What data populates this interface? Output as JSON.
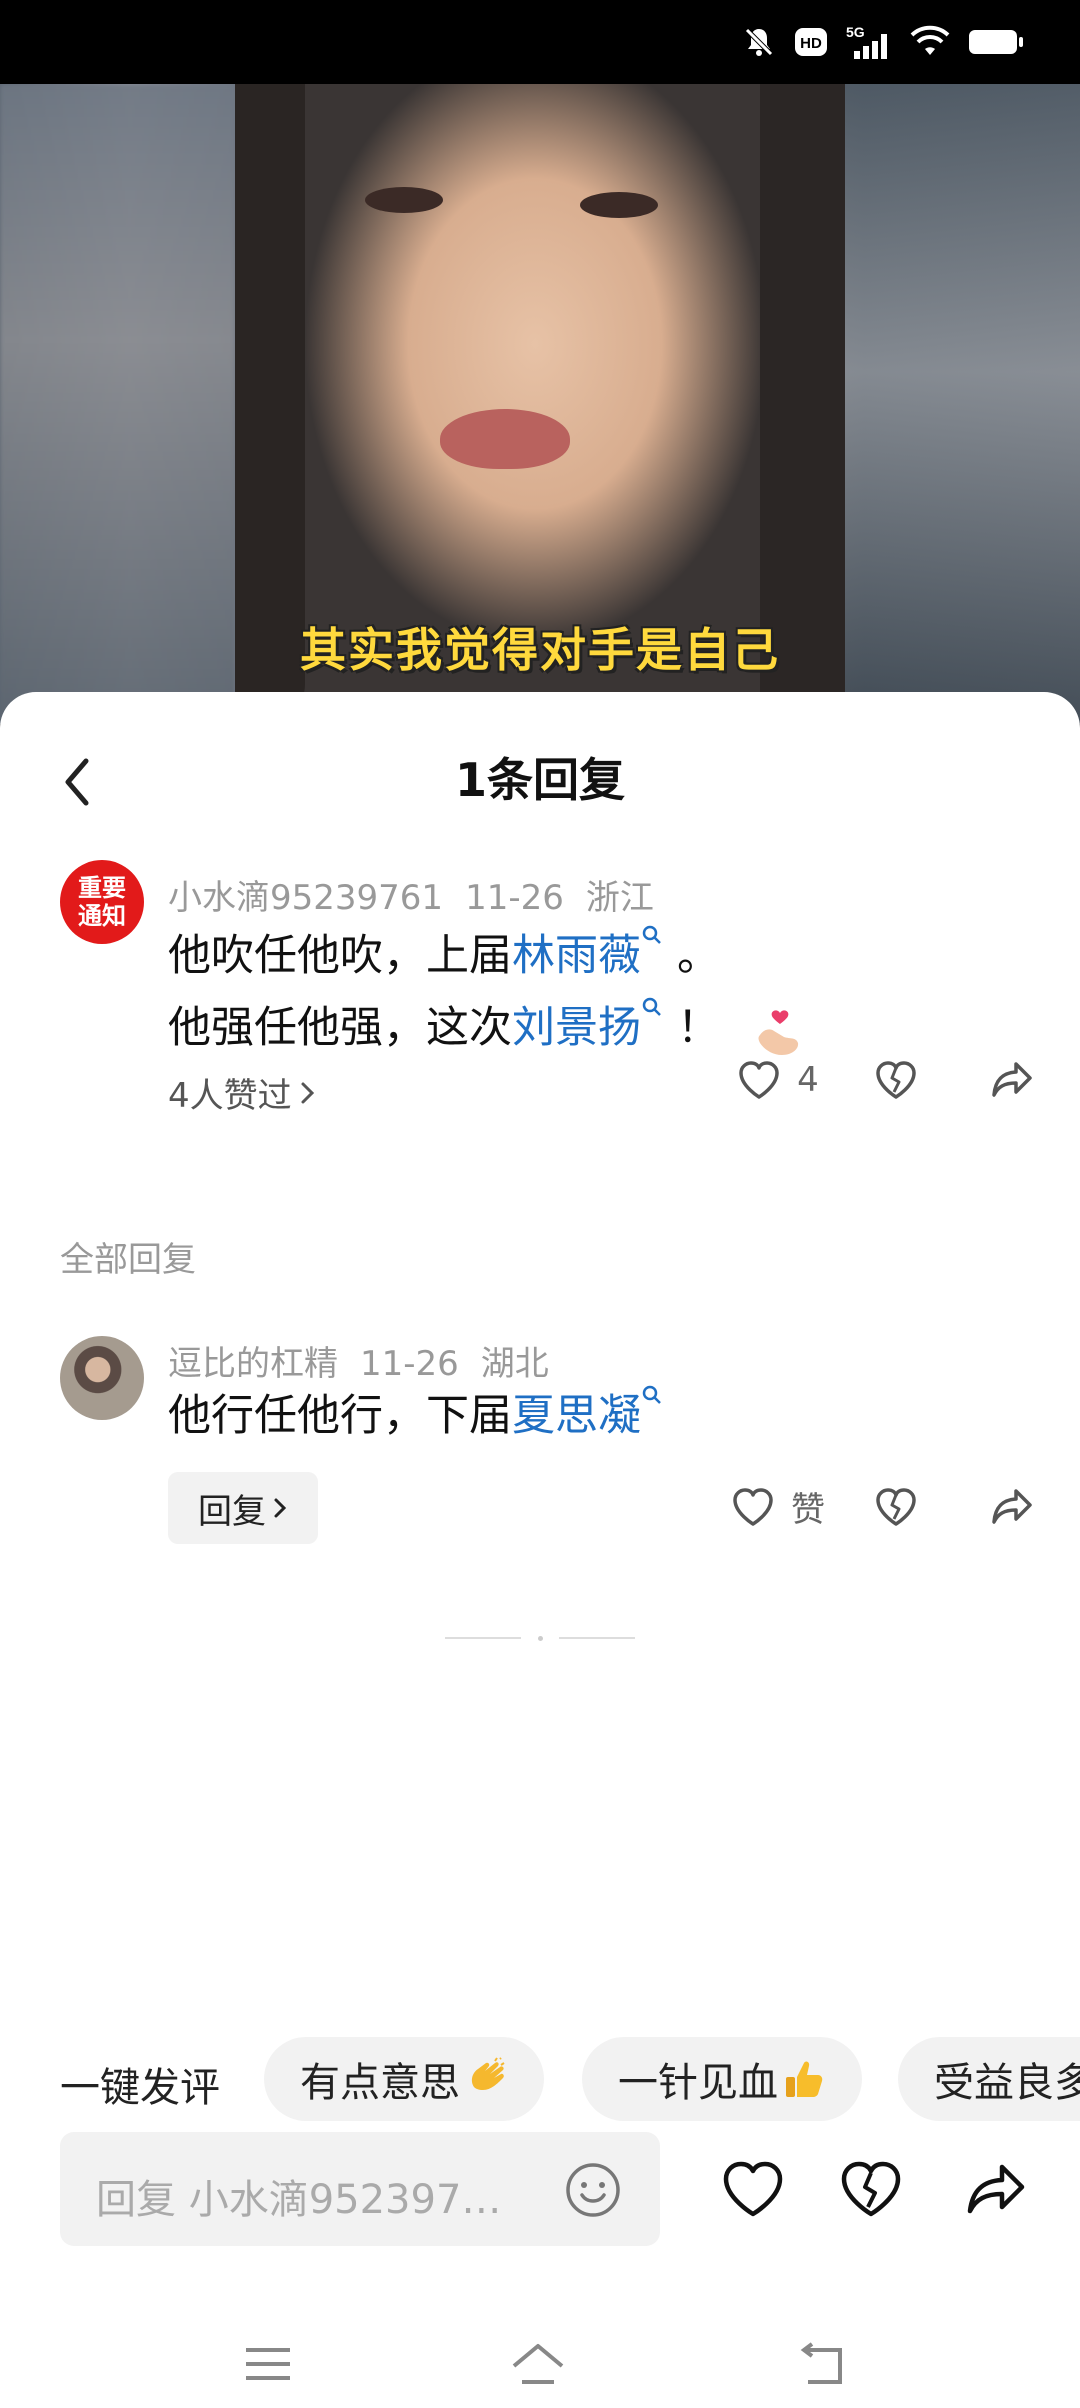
{
  "status_bar": {
    "network": "5G",
    "hd_badge": "HD",
    "icons": [
      "mute-icon",
      "hd-icon",
      "signal-icon",
      "wifi-icon",
      "battery-icon"
    ]
  },
  "video": {
    "caption": "其实我觉得对手是自己"
  },
  "sheet": {
    "title": "1条回复"
  },
  "main_comment": {
    "avatar_text_line1": "重要",
    "avatar_text_line2": "通知",
    "username": "小水滴95239761",
    "date": "11-26",
    "location": "浙江",
    "line1_prefix": "他吹任他吹，上届",
    "line1_keyword": "林雨薇",
    "line1_suffix": "。",
    "line2_prefix": "他强任他强，这次",
    "line2_keyword": "刘景扬",
    "line2_suffix": "！",
    "emoji": "finger-heart-emoji",
    "likes_text": "4人赞过",
    "like_count": "4"
  },
  "section_label": "全部回复",
  "reply": {
    "username": "逗比的杠精",
    "date": "11-26",
    "location": "湖北",
    "text_prefix": "他行任他行，下届",
    "text_keyword": "夏思凝",
    "reply_button": "回复",
    "like_label": "赞"
  },
  "quick_comment": {
    "label": "一键发评",
    "chips": [
      {
        "text": "有点意思",
        "emoji": "clapping-hands-emoji"
      },
      {
        "text": "一针见血",
        "emoji": "thumbs-up-emoji"
      },
      {
        "text": "受益良多",
        "emoji": ""
      }
    ]
  },
  "input": {
    "placeholder": "回复 小水滴952397…"
  },
  "colors": {
    "link": "#1f6fc4",
    "badge_red": "#e21a1a",
    "caption_yellow": "#ffd93d"
  }
}
